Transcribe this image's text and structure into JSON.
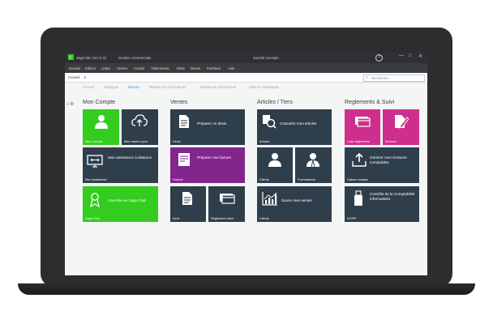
{
  "window": {
    "app_title": "Sage 50c Ciel (1.0)",
    "module": "Gestion commerciale",
    "company": "Société exemple",
    "help": "?",
    "minimize": "—",
    "maximize": "□",
    "close": "✕"
  },
  "menu": [
    "Dossier",
    "Edition",
    "Listes",
    "Ventes",
    "Achats",
    "Traitements",
    "Etats",
    "Divers",
    "Fenêtres",
    "Aide"
  ],
  "toolbar": {
    "nav_label": "Accueil",
    "nav_chevron": "∨",
    "search_placeholder": "Recherche..."
  },
  "tabs": [
    "Accueil",
    "Réglages",
    "Bureau",
    "Tableau de bord manuel",
    "Tableau de bord annuel",
    "États et statistiques"
  ],
  "groups": {
    "mon_compte": "Mon Compte",
    "ventes": "Ventes",
    "articles": "Articles / Tiers",
    "reglements": "Reglements & Suivi"
  },
  "tiles": {
    "mon_compte": {
      "label": "Mon Compte"
    },
    "mises_a_jour": {
      "label": "Mon mises à jour"
    },
    "assistance": {
      "caption": "Mon assistance à distance",
      "label": "Mon Assistance"
    },
    "sage_club": {
      "caption": "J'accède au Sage Club",
      "label": "Sage Club"
    },
    "devis": {
      "caption": "Préparer un devis",
      "label": "Devis"
    },
    "facture": {
      "caption": "Préparer une facture",
      "label": "Facture"
    },
    "avoir": {
      "label": "Avoir"
    },
    "reglement_client": {
      "label": "Règlement client"
    },
    "articles": {
      "caption": "Consulter mes articles",
      "label": "Articles"
    },
    "clients": {
      "label": "Clients"
    },
    "fournisseurs": {
      "label": "Fournisseurs"
    },
    "ventes_clients": {
      "caption": "Suivre mes ventes",
      "label": "Clients"
    },
    "liste_reglements": {
      "label": "Liste règlements"
    },
    "relance": {
      "label": "Relance"
    },
    "liaison_compta": {
      "caption": "Générer mes écritures comptables",
      "label": "Liaison compta"
    },
    "dgfip": {
      "caption": "Contrôle de la Comptabilité Informatisée",
      "label": "DGFiP"
    }
  },
  "colors": {
    "green": "#33cc1f",
    "dark_tile": "#2f3e4b",
    "purple": "#82268e",
    "pink": "#ce2f8f",
    "accent_tab": "#4a8bc9"
  }
}
